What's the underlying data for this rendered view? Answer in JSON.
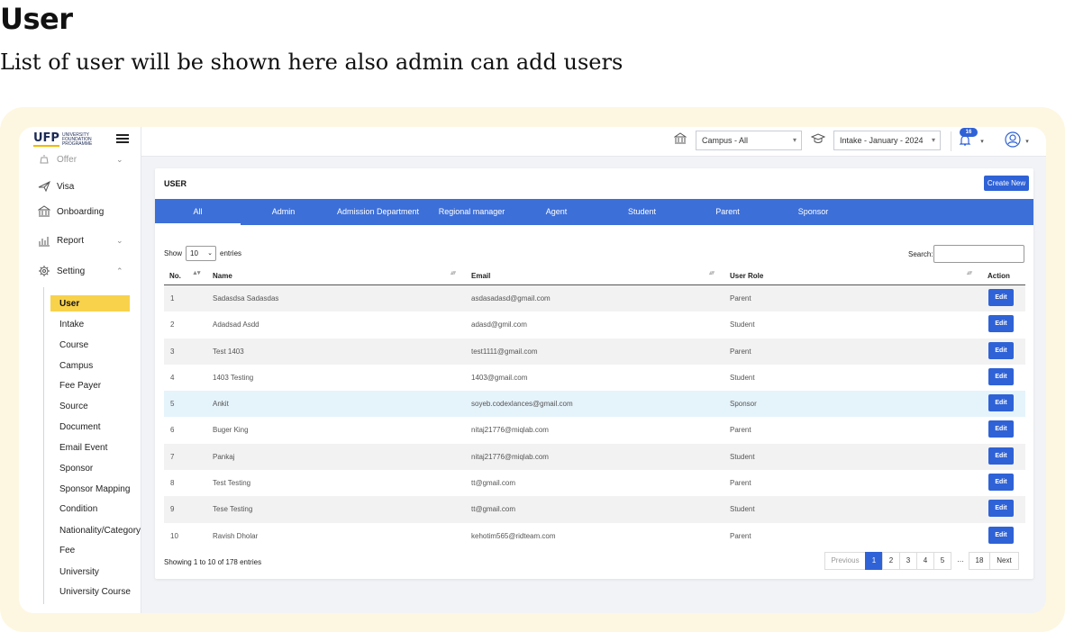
{
  "page": {
    "title": "User",
    "subtitle": "List of user will be shown here also admin can add users"
  },
  "sidebar": {
    "logo_mark": "UFP",
    "logo_text": "UNIVERSITY FOUNDATION PROGRAMME",
    "items": [
      {
        "label": "Offer",
        "icon": "offer-icon"
      },
      {
        "label": "Visa",
        "icon": "plane-icon"
      },
      {
        "label": "Onboarding",
        "icon": "bank-icon"
      },
      {
        "label": "Report",
        "icon": "bar-chart-icon"
      },
      {
        "label": "Setting",
        "icon": "gear-icon"
      }
    ],
    "sub_items": [
      "User",
      "Intake",
      "Course",
      "Campus",
      "Fee Payer",
      "Source",
      "Document",
      "Email Event",
      "Sponsor",
      "Sponsor Mapping",
      "Condition",
      "Nationality/Category",
      "Fee",
      "University",
      "University Course"
    ]
  },
  "header": {
    "campus_value": "Campus - All",
    "intake_value": "Intake - January - 2024",
    "notification_count": "16"
  },
  "card": {
    "title": "USER",
    "create_label": "Create New",
    "tabs": [
      "All",
      "Admin",
      "Admission Department",
      "Regional manager",
      "Agent",
      "Student",
      "Parent",
      "Sponsor"
    ],
    "show_label": "Show",
    "entries_value": "10",
    "entries_label": "entries",
    "search_label": "Search:",
    "columns": [
      "No.",
      "Name",
      "Email",
      "User Role",
      "Action"
    ],
    "rows": [
      {
        "no": "1",
        "name": "Sadasdsa Sadasdas",
        "email": "asdasadasd@gmail.com",
        "role": "Parent"
      },
      {
        "no": "2",
        "name": "Adadsad Asdd",
        "email": "adasd@gmil.com",
        "role": "Student"
      },
      {
        "no": "3",
        "name": "Test 1403",
        "email": "test1111@gmail.com",
        "role": "Parent"
      },
      {
        "no": "4",
        "name": "1403 Testing",
        "email": "1403@gmail.com",
        "role": "Student"
      },
      {
        "no": "5",
        "name": "Ankit",
        "email": "soyeb.codexlances@gmail.com",
        "role": "Sponsor"
      },
      {
        "no": "6",
        "name": "Buger King",
        "email": "nitaj21776@miqlab.com",
        "role": "Parent"
      },
      {
        "no": "7",
        "name": "Pankaj",
        "email": "nitaj21776@miqlab.com",
        "role": "Student"
      },
      {
        "no": "8",
        "name": "Test Testing",
        "email": "tt@gmail.com",
        "role": "Parent"
      },
      {
        "no": "9",
        "name": "Tese Testing",
        "email": "tt@gmail.com",
        "role": "Student"
      },
      {
        "no": "10",
        "name": "Ravish Dholar",
        "email": "kehotim565@ridteam.com",
        "role": "Parent"
      }
    ],
    "edit_label": "Edit",
    "info": "Showing 1 to 10 of 178 entries",
    "pagination": {
      "previous": "Previous",
      "pages": [
        "1",
        "2",
        "3",
        "4",
        "5"
      ],
      "ellipsis": "…",
      "last": "18",
      "next": "Next"
    }
  }
}
